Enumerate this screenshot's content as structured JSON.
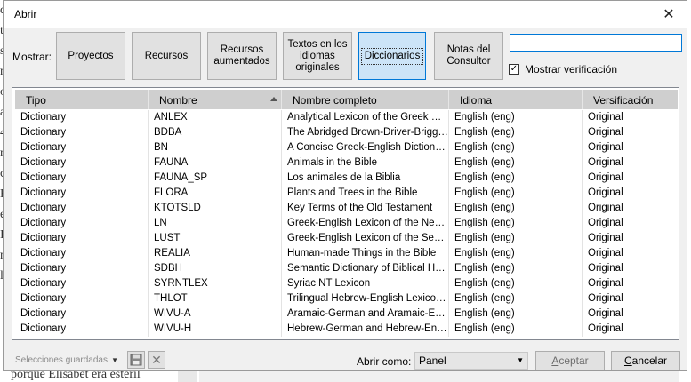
{
  "dialog": {
    "title": "Abrir",
    "close_glyph": "✕"
  },
  "filters": {
    "label": "Mostrar:",
    "buttons": [
      {
        "label": "Proyectos",
        "active": false
      },
      {
        "label": "Recursos",
        "active": false
      },
      {
        "label": "Recursos\naumentados",
        "active": false
      },
      {
        "label": "Textos en los\nidiomas\noriginales",
        "active": false
      },
      {
        "label": "Diccionarios",
        "active": true
      },
      {
        "label": "Notas del\nConsultor",
        "active": false
      }
    ]
  },
  "search": {
    "value": "",
    "placeholder": ""
  },
  "show_verification": {
    "label": "Mostrar verificación",
    "checked": true,
    "check_glyph": "✓"
  },
  "table": {
    "columns": [
      "Tipo",
      "Nombre",
      "Nombre completo",
      "Idioma",
      "Versificación"
    ],
    "rows": [
      [
        "Dictionary",
        "ANLEX",
        "Analytical Lexicon of the Greek Ne...",
        "English (eng)",
        "Original"
      ],
      [
        "Dictionary",
        "BDBA",
        "The Abridged Brown-Driver-Briggs ...",
        "English (eng)",
        "Original"
      ],
      [
        "Dictionary",
        "BN",
        "A Concise Greek-English Dictionar...",
        "English (eng)",
        "Original"
      ],
      [
        "Dictionary",
        "FAUNA",
        "Animals in the Bible",
        "English (eng)",
        "Original"
      ],
      [
        "Dictionary",
        "FAUNA_SP",
        "Los animales de la Biblia",
        "English (eng)",
        "Original"
      ],
      [
        "Dictionary",
        "FLORA",
        "Plants and Trees in the Bible",
        "English (eng)",
        "Original"
      ],
      [
        "Dictionary",
        "KTOTSLD",
        "Key Terms of the Old Testament",
        "English (eng)",
        "Original"
      ],
      [
        "Dictionary",
        "LN",
        "Greek-English Lexicon of the New ...",
        "English (eng)",
        "Original"
      ],
      [
        "Dictionary",
        "LUST",
        "Greek-English Lexicon of the Sept...",
        "English (eng)",
        "Original"
      ],
      [
        "Dictionary",
        "REALIA",
        "Human-made Things in the Bible",
        "English (eng)",
        "Original"
      ],
      [
        "Dictionary",
        "SDBH",
        "Semantic Dictionary of Biblical Heb...",
        "English (eng)",
        "Original"
      ],
      [
        "Dictionary",
        "SYRNTLEX",
        "Syriac NT Lexicon",
        "English (eng)",
        "Original"
      ],
      [
        "Dictionary",
        "THLOT",
        "Trilingual Hebrew-English Lexicon ...",
        "English (eng)",
        "Original"
      ],
      [
        "Dictionary",
        "WIVU-A",
        "Aramaic-German and Aramaic-Engli...",
        "English (eng)",
        "Original"
      ],
      [
        "Dictionary",
        "WIVU-H",
        "Hebrew-German and Hebrew-Engli...",
        "English (eng)",
        "Original"
      ]
    ]
  },
  "footer": {
    "saved_selections": "Selecciones guardadas",
    "open_as_label": "Abrir como:",
    "open_as_value": "Panel",
    "accept_first": "A",
    "accept_rest": "ceptar",
    "cancel_first": "C",
    "cancel_rest": "ancelar"
  },
  "background": {
    "left_letters": [
      "d",
      "tr",
      "s",
      "n",
      "o",
      "a",
      "4",
      "n",
      "c",
      "H",
      "e",
      "I",
      "n",
      "la"
    ],
    "bottom_text": "porque Elisabet era estéril"
  },
  "colors": {
    "accent": "#0078d7",
    "active_button": "#cce4f7",
    "header": "#cfcfcf",
    "dialog_bg": "#f0f0f0"
  }
}
